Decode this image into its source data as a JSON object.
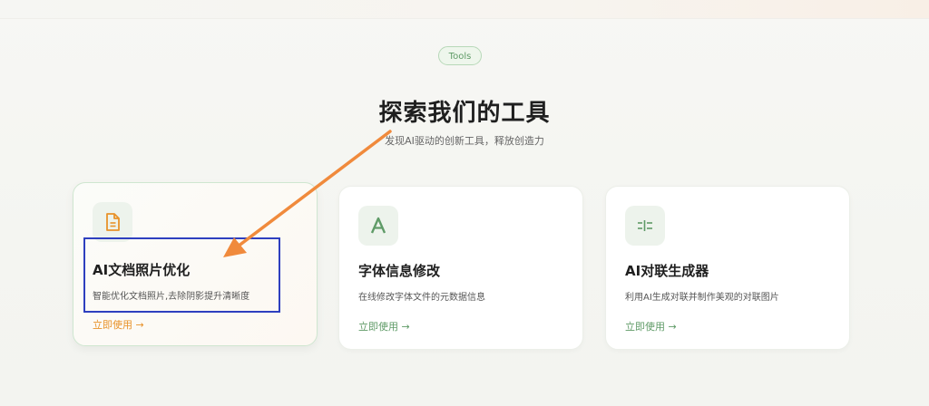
{
  "header": {
    "badge": "Tools",
    "title": "探索我们的工具",
    "subtitle": "发现AI驱动的创新工具，释放创造力"
  },
  "cards": [
    {
      "title": "AI文档照片优化",
      "description": "智能优化文档照片,去除阴影提升清晰度",
      "link": "立即使用 →",
      "icon": "document-icon"
    },
    {
      "title": "字体信息修改",
      "description": "在线修改字体文件的元数据信息",
      "link": "立即使用 →",
      "icon": "font-a-icon"
    },
    {
      "title": "AI对联生成器",
      "description": "利用AI生成对联并制作美观的对联图片",
      "link": "立即使用 →",
      "icon": "couplet-icon"
    }
  ],
  "colors": {
    "accent_green": "#5f9b67",
    "accent_orange": "#e8922a",
    "annotation_blue": "#2e3fbf",
    "annotation_arrow": "#f08a3c"
  }
}
